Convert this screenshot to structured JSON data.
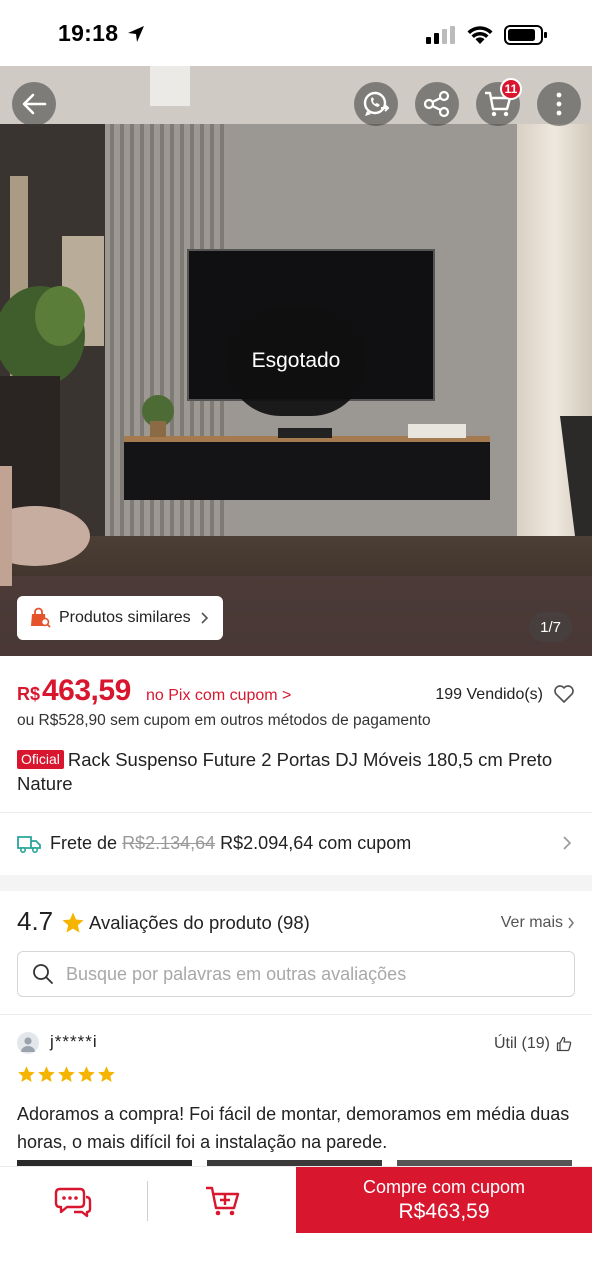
{
  "status_bar": {
    "time": "19:18"
  },
  "hero": {
    "soldout_label": "Esgotado",
    "similar_label": "Produtos similares",
    "image_counter": "1/7",
    "cart_count": "11"
  },
  "product": {
    "currency": "R$",
    "price": "463,59",
    "pix_note": "no Pix com cupom >",
    "sold": "199 Vendido(s)",
    "alt_price": "ou R$528,90 sem cupom em outros métodos de pagamento",
    "official_badge": "Oficial",
    "title": "Rack Suspenso Future 2 Portas DJ Móveis 180,5 cm Preto Nature"
  },
  "shipping": {
    "label": "Frete de",
    "old_price": "R$2.134,64",
    "new_price": "R$2.094,64 com cupom"
  },
  "reviews": {
    "rating": "4.7",
    "label": "Avaliações do produto",
    "count": "(98)",
    "see_more": "Ver mais",
    "search_placeholder": "Busque por palavras em outras avaliações",
    "first": {
      "user": "j*****i",
      "helpful": "Útil (19)",
      "stars": 5,
      "text": "Adoramos a compra! Foi fácil de montar, demoramos em média duas horas, o mais difícil foi a instalação na parede."
    }
  },
  "bottom_bar": {
    "buy_label": "Compre com cupom",
    "buy_price": "R$463,59"
  },
  "colors": {
    "accent": "#d8172f",
    "star": "#f5b400"
  }
}
